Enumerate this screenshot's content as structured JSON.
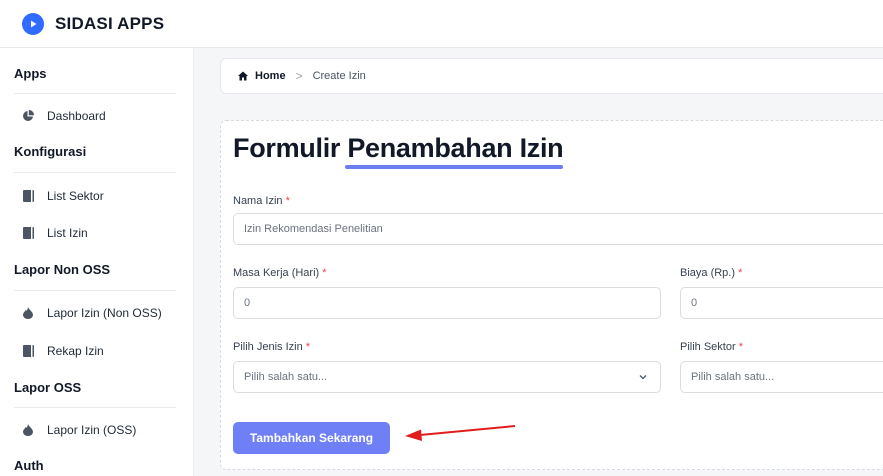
{
  "app": {
    "title": "SIDASI APPS"
  },
  "colors": {
    "accent": "#6f7ff5",
    "brand": "#2f6bff",
    "required": "#ef4444",
    "annotation_arrow": "#e11d1d"
  },
  "sidebar": {
    "sections": [
      {
        "title": "Apps",
        "items": [
          {
            "label": "Dashboard",
            "icon": "pie-chart-icon"
          }
        ]
      },
      {
        "title": "Konfigurasi",
        "items": [
          {
            "label": "List Sektor",
            "icon": "book-icon"
          },
          {
            "label": "List Izin",
            "icon": "book-icon"
          }
        ]
      },
      {
        "title": "Lapor Non OSS",
        "items": [
          {
            "label": "Lapor Izin (Non OSS)",
            "icon": "fire-icon"
          },
          {
            "label": "Rekap Izin",
            "icon": "book-icon"
          }
        ]
      },
      {
        "title": "Lapor OSS",
        "items": [
          {
            "label": "Lapor Izin (OSS)",
            "icon": "fire-icon"
          }
        ]
      },
      {
        "title": "Auth",
        "items": []
      }
    ]
  },
  "breadcrumb": {
    "home": "Home",
    "separator": ">",
    "current": "Create Izin"
  },
  "form": {
    "title_plain": "Formulir ",
    "title_highlight": "Penambahan Izin",
    "required_mark": "*",
    "fields": {
      "nama_izin": {
        "label": "Nama Izin",
        "placeholder": "Izin Rekomendasi Penelitian"
      },
      "masa_kerja": {
        "label": "Masa Kerja (Hari)",
        "placeholder": "0"
      },
      "biaya": {
        "label": "Biaya (Rp.)",
        "placeholder": "0"
      },
      "jenis_izin": {
        "label": "Pilih Jenis Izin",
        "placeholder": "Pilih salah satu..."
      },
      "sektor": {
        "label": "Pilih Sektor",
        "placeholder": "Pilih salah satu..."
      }
    },
    "submit_label": "Tambahkan Sekarang"
  }
}
